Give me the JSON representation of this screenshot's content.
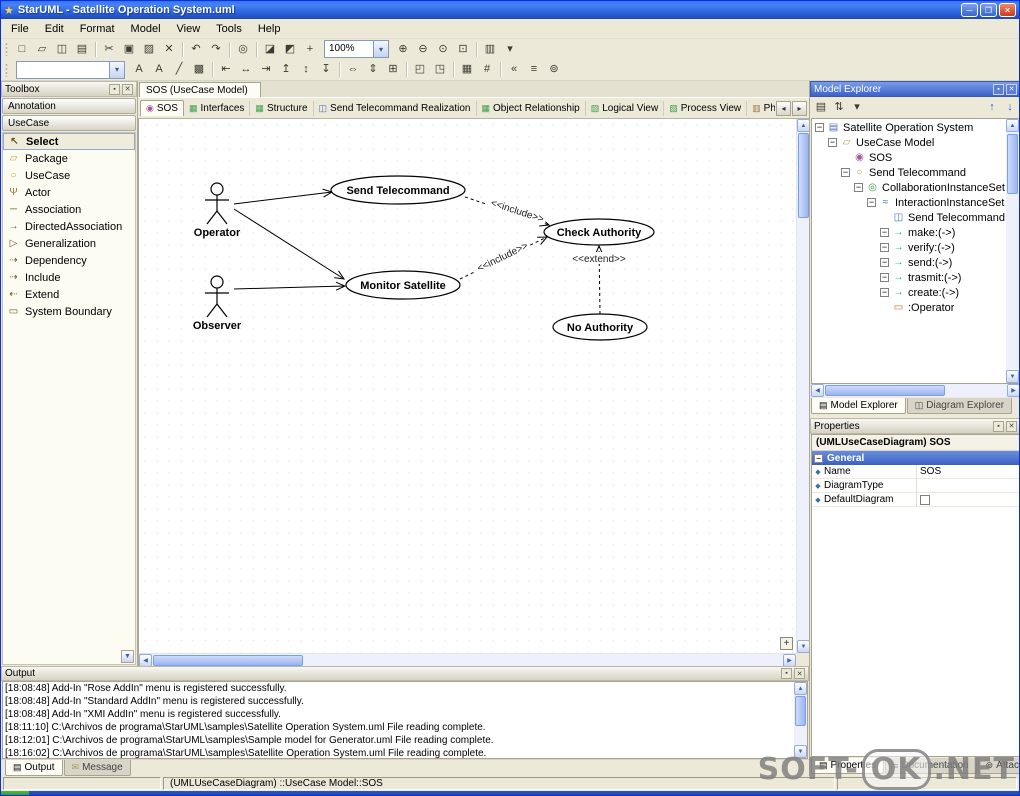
{
  "window": {
    "title": "StarUML - Satellite Operation System.uml"
  },
  "menus": [
    "File",
    "Edit",
    "Format",
    "Model",
    "View",
    "Tools",
    "Help"
  ],
  "toolbar_standard": {
    "icons": [
      "new",
      "open",
      "save",
      "print",
      "|",
      "cut",
      "copy",
      "paste",
      "delete",
      "|",
      "undo",
      "redo",
      "|",
      "find",
      "|",
      "add-diagram",
      "add-model",
      "add-element"
    ],
    "zoom_value": "100%",
    "zoom_icons": [
      "zoom-in",
      "zoom-out",
      "zoom-actual",
      "zoom-fit",
      "|",
      "page-layout",
      "dropdown"
    ]
  },
  "toolbar_format": {
    "combo_value": "",
    "icons": [
      "font",
      "font-color",
      "line-color",
      "fill-color",
      "|",
      "align-left",
      "align-center",
      "align-right",
      "align-top",
      "align-middle",
      "align-bottom",
      "|",
      "same-width",
      "same-height",
      "same-size",
      "|",
      "bring-to-front",
      "send-to-back",
      "|",
      "show-grid",
      "snap-grid",
      "|",
      "stereotype",
      "documentation",
      "attachment"
    ]
  },
  "toolbox": {
    "title": "Toolbox",
    "groups": [
      "Annotation",
      "UseCase"
    ],
    "items": [
      {
        "icon": "select",
        "label": "Select",
        "active": true
      },
      {
        "icon": "package",
        "label": "Package"
      },
      {
        "icon": "usecase",
        "label": "UseCase"
      },
      {
        "icon": "actor",
        "label": "Actor"
      },
      {
        "icon": "association",
        "label": "Association"
      },
      {
        "icon": "directed-association",
        "label": "DirectedAssociation"
      },
      {
        "icon": "generalization",
        "label": "Generalization"
      },
      {
        "icon": "dependency",
        "label": "Dependency"
      },
      {
        "icon": "include",
        "label": "Include"
      },
      {
        "icon": "extend",
        "label": "Extend"
      },
      {
        "icon": "system-boundary",
        "label": "System Boundary"
      }
    ]
  },
  "canvas": {
    "doc_tab": "SOS (UseCase Model)",
    "diagram_tabs": [
      {
        "icon": "usecase-diagram",
        "label": "SOS",
        "active": true
      },
      {
        "icon": "class-diagram",
        "label": "Interfaces"
      },
      {
        "icon": "class-diagram",
        "label": "Structure"
      },
      {
        "icon": "sequence-diagram",
        "label": "Send Telecommand Realization"
      },
      {
        "icon": "class-diagram",
        "label": "Object Relationship"
      },
      {
        "icon": "package-diagram",
        "label": "Logical View"
      },
      {
        "icon": "package-diagram",
        "label": "Process View"
      },
      {
        "icon": "deployment-diagram",
        "label": "Physical View"
      }
    ]
  },
  "diagram": {
    "actors": [
      {
        "label": "Operator"
      },
      {
        "label": "Observer"
      }
    ],
    "usecases": [
      {
        "label": "Send Telecommand"
      },
      {
        "label": "Monitor Satellite"
      },
      {
        "label": "Check Authority"
      },
      {
        "label": "No Authority"
      }
    ],
    "stereotypes": {
      "include1": "<<include>>",
      "include2": "<<include>>",
      "extend": "<<extend>>"
    }
  },
  "model_explorer": {
    "title": "Model Explorer",
    "toolbar_icons": [
      "flat-view",
      "sort-alpha",
      "display-options"
    ],
    "nav_icons": [
      "move-up",
      "move-down"
    ],
    "tree": [
      {
        "depth": 0,
        "icon": "model",
        "label": "Satellite Operation System",
        "expander": "minus"
      },
      {
        "depth": 1,
        "icon": "package",
        "label": "UseCase Model",
        "expander": "minus"
      },
      {
        "depth": 2,
        "icon": "usecase-diagram",
        "label": "SOS",
        "expander": "none"
      },
      {
        "depth": 2,
        "icon": "usecase",
        "label": "Send Telecommand",
        "expander": "minus"
      },
      {
        "depth": 3,
        "icon": "collaboration",
        "label": "CollaborationInstanceSet1",
        "expander": "minus"
      },
      {
        "depth": 4,
        "icon": "interaction",
        "label": "InteractionInstanceSet1",
        "expander": "minus"
      },
      {
        "depth": 5,
        "icon": "seq-diagram",
        "label": "Send Telecommand Rea",
        "expander": "none"
      },
      {
        "depth": 5,
        "icon": "message",
        "label": "make:(->)",
        "expander": "minus"
      },
      {
        "depth": 5,
        "icon": "message",
        "label": "verify:(->)",
        "expander": "minus"
      },
      {
        "depth": 5,
        "icon": "message",
        "label": "send:(->)",
        "expander": "minus"
      },
      {
        "depth": 5,
        "icon": "message",
        "label": "trasmit:(->)",
        "expander": "minus"
      },
      {
        "depth": 5,
        "icon": "message",
        "label": "create:(->)",
        "expander": "minus"
      },
      {
        "depth": 5,
        "icon": "object",
        "label": ":Operator",
        "expander": "none"
      }
    ],
    "tabs": [
      {
        "icon": "model-explorer",
        "label": "Model Explorer",
        "active": true
      },
      {
        "icon": "diagram-explorer",
        "label": "Diagram Explorer"
      }
    ]
  },
  "properties": {
    "title": "Properties",
    "header": "(UMLUseCaseDiagram) SOS",
    "section": "General",
    "rows": [
      {
        "label": "Name",
        "value": "SOS"
      },
      {
        "label": "DiagramType",
        "value": ""
      },
      {
        "label": "DefaultDiagram",
        "value": "",
        "type": "checkbox"
      }
    ],
    "tabs": [
      {
        "icon": "properties-tab",
        "label": "Properties",
        "active": true
      },
      {
        "icon": "documentation-tab",
        "label": "Documentation"
      },
      {
        "icon": "attachments-tab",
        "label": "Attachments"
      }
    ]
  },
  "output": {
    "title": "Output",
    "lines": [
      "[18:08:48] Add-In \"Rose AddIn\" menu is registered successfully.",
      "[18:08:48] Add-In \"Standard AddIn\" menu is registered successfully.",
      "[18:08:48] Add-In \"XMI AddIn\" menu is registered successfully.",
      "[18:11:10] C:\\Archivos de programa\\StarUML\\samples\\Satellite Operation System.uml File reading complete.",
      "[18:12:01] C:\\Archivos de programa\\StarUML\\samples\\Sample model for Generator.uml File reading complete.",
      "[18:16:02] C:\\Archivos de programa\\StarUML\\samples\\Satellite Operation System.uml File reading complete."
    ],
    "tabs": [
      {
        "icon": "output",
        "label": "Output",
        "active": true
      },
      {
        "icon": "message-tab",
        "label": "Message"
      }
    ]
  },
  "statusbar": {
    "text": "(UMLUseCaseDiagram) ::UseCase Model::SOS"
  },
  "watermark": {
    "part1": "SOFT-",
    "part2": "OK",
    "part3": ".NET"
  }
}
